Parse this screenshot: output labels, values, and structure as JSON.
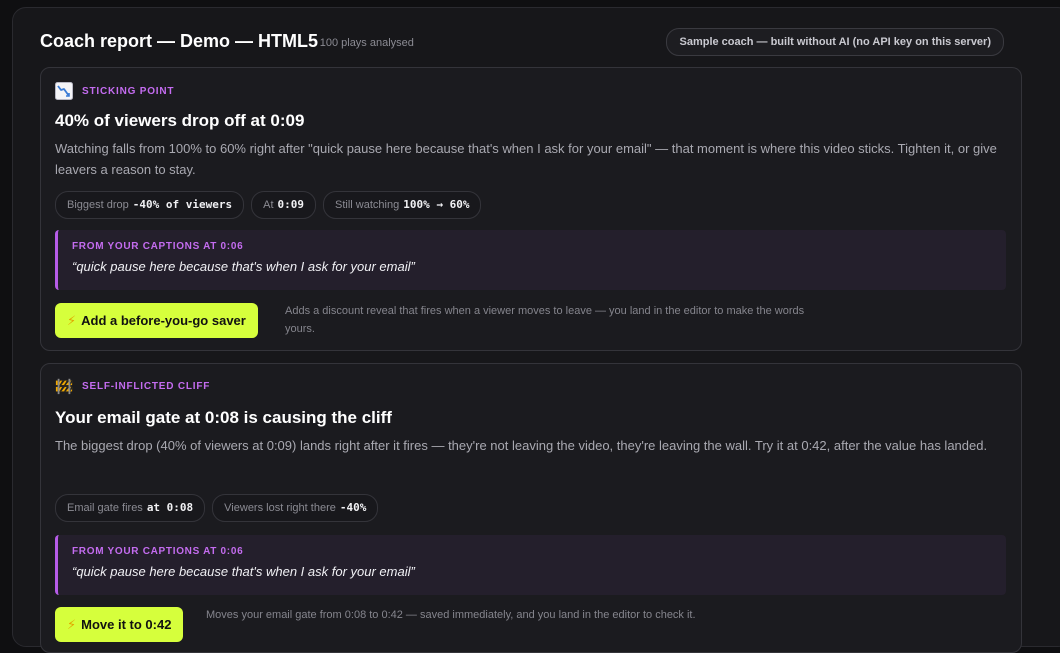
{
  "header": {
    "title": "Coach report — Demo — HTML5",
    "subtitle": "· 100 plays analysed",
    "badge": "Sample coach — built without AI (no API key on this server)"
  },
  "cards": [
    {
      "icon": "chart-down-icon",
      "kicker": "STICKING POINT",
      "title": "40% of viewers drop off at 0:09",
      "body": "Watching falls from 100% to 60% right after \"quick pause here because that's when I ask for your email\" — that moment is where this video sticks. Tighten it, or give leavers a reason to stay.",
      "chips": [
        {
          "label": "Biggest drop",
          "value": "-40% of viewers"
        },
        {
          "label": "At",
          "value": "0:09"
        },
        {
          "label": "Still watching",
          "value": "100% → 60%"
        }
      ],
      "quote_label": "FROM YOUR CAPTIONS AT 0:06",
      "quote_text": "“quick pause here because that's when I ask for your email”",
      "action_label": "Add a before-you-go saver",
      "action_note": "Adds a discount reveal that fires when a viewer moves to leave — you land in the editor to make the words yours."
    },
    {
      "icon": "barrier-icon",
      "kicker": "SELF-INFLICTED CLIFF",
      "title": "Your email gate at 0:08 is causing the cliff",
      "body": "The biggest drop (40% of viewers at 0:09) lands right after it fires — they're not leaving the video, they're leaving the wall. Try it at 0:42, after the value has landed.",
      "chips": [
        {
          "label": "Email gate fires",
          "value": "at 0:08"
        },
        {
          "label": "Viewers lost right there",
          "value": "-40%"
        }
      ],
      "quote_label": "FROM YOUR CAPTIONS AT 0:06",
      "quote_text": "“quick pause here because that's when I ask for your email”",
      "action_label": "Move it to 0:42",
      "action_note": "Moves your email gate from 0:08 to 0:42 — saved immediately, and you land in the editor to check it."
    }
  ],
  "colors": {
    "accent": "#d6ff3c",
    "kicker": "#c46cf0",
    "quote_bar": "#b65ce8"
  }
}
